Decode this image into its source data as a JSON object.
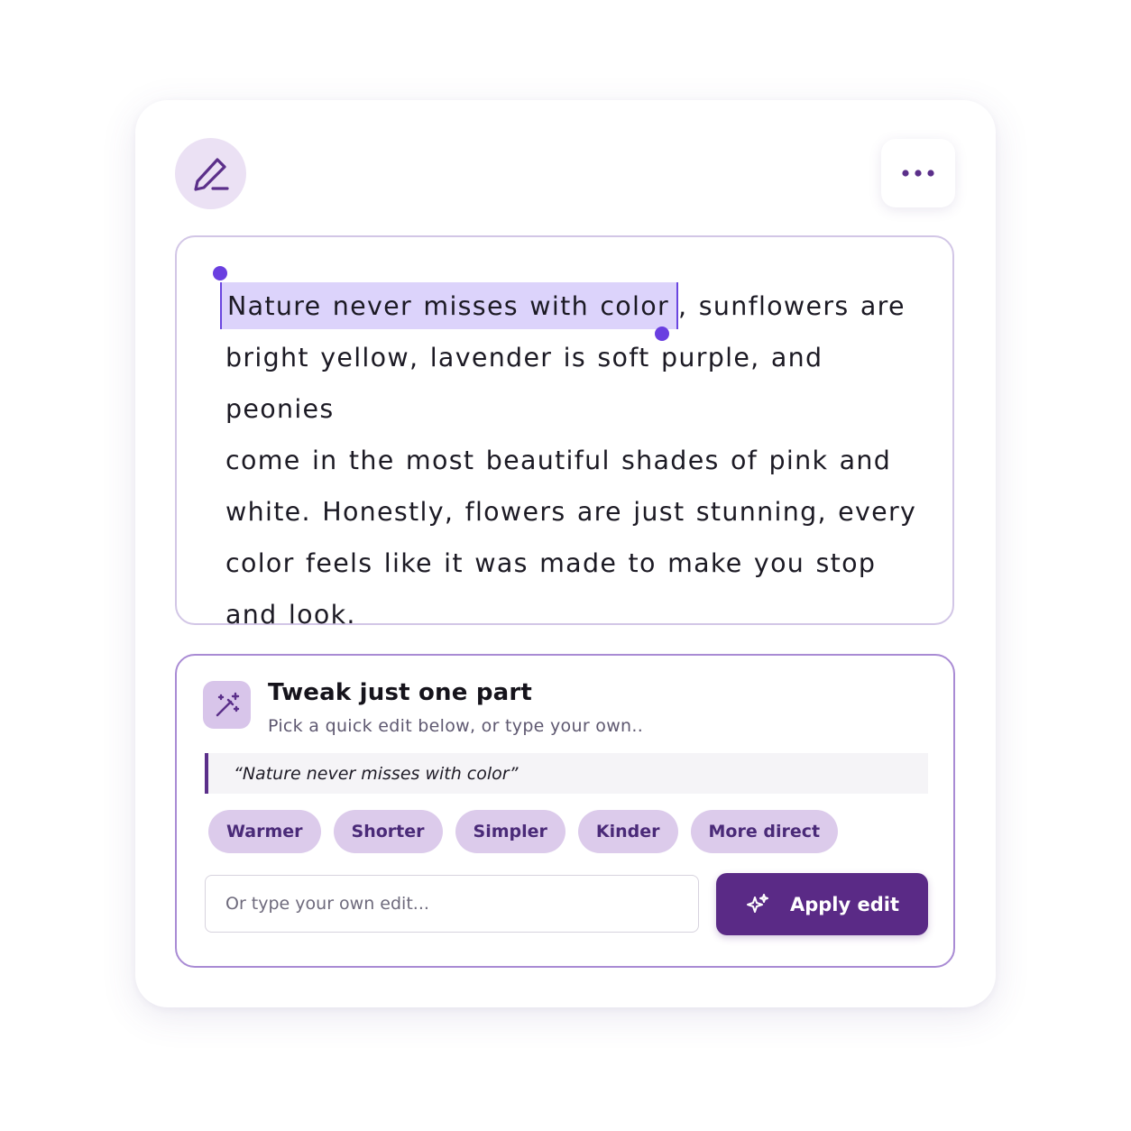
{
  "header": {
    "left_icon": "pen-edit-icon",
    "menu_icon": "more-horizontal-icon"
  },
  "passage": {
    "selected_text": "Nature never misses with color",
    "line1_rest": ", sunflowers are",
    "line2": "bright yellow, lavender is soft purple, and peonies",
    "line3": "come in the most beautiful shades of pink and",
    "line4": "white. Honestly, flowers are just stunning, every",
    "line5": "color feels like it was made to make you stop",
    "line6": "and look."
  },
  "tweak_panel": {
    "icon": "magic-wand-icon",
    "title": "Tweak just one part",
    "subtitle": "Pick a quick edit below, or type your own..",
    "quote": "“Nature never misses with color”",
    "chips": [
      {
        "label": "Warmer"
      },
      {
        "label": "Shorter"
      },
      {
        "label": "Simpler"
      },
      {
        "label": "Kinder"
      },
      {
        "label": "More direct"
      }
    ],
    "input_placeholder": "Or type your own edit...",
    "apply_label": "Apply edit",
    "apply_icon": "sparkles-icon"
  },
  "colors": {
    "accent": "#5a2a86",
    "highlight": "#dcd3fb",
    "selection_handle": "#6a3fe0",
    "chip_bg": "#dccbeb"
  }
}
